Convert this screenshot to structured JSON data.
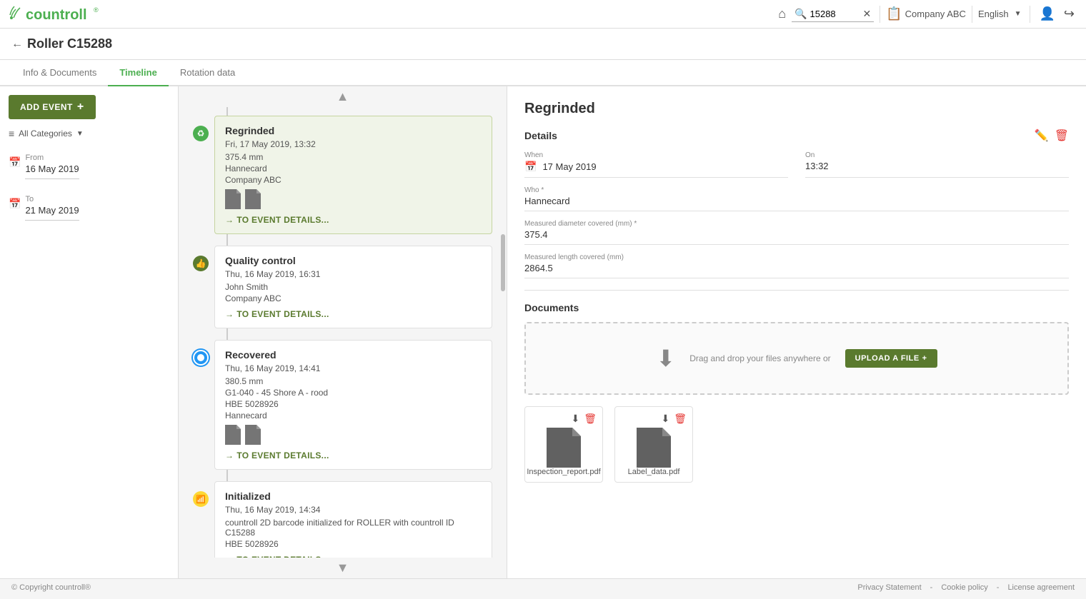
{
  "logo": {
    "text": "countroll",
    "trademark": "®"
  },
  "header": {
    "search_value": "15288",
    "company": "Company ABC",
    "language": "English",
    "home_icon": "home-icon",
    "search_icon": "search-icon",
    "clear_icon": "clear-icon",
    "business_icon": "business-icon",
    "lang_chevron": "chevron-down-icon",
    "account_icon": "account-icon",
    "logout_icon": "logout-icon"
  },
  "page": {
    "back_label": "←",
    "title": "Roller C15288"
  },
  "tabs": [
    {
      "id": "info",
      "label": "Info & Documents"
    },
    {
      "id": "timeline",
      "label": "Timeline"
    },
    {
      "id": "rotation",
      "label": "Rotation data"
    }
  ],
  "active_tab": "timeline",
  "sidebar": {
    "add_event_label": "ADD EVENT",
    "filter_label": "All Categories",
    "from_label": "From",
    "from_value": "16 May 2019",
    "to_label": "To",
    "to_value": "21 May 2019"
  },
  "timeline_events": [
    {
      "id": "evt1",
      "type": "regrinded",
      "title": "Regrinded",
      "datetime": "Fri, 17 May 2019, 13:32",
      "detail1": "375.4 mm",
      "detail2": "Hannecard",
      "detail3": "Company ABC",
      "has_docs": true,
      "link_label": "TO EVENT DETAILS...",
      "node_type": "green_recycle",
      "active": true
    },
    {
      "id": "evt2",
      "type": "quality_control",
      "title": "Quality control",
      "datetime": "Thu, 16 May 2019, 16:31",
      "detail1": "John Smith",
      "detail2": "Company ABC",
      "has_docs": false,
      "link_label": "TO EVENT DETAILS...",
      "node_type": "thumb_up",
      "active": false
    },
    {
      "id": "evt3",
      "type": "recovered",
      "title": "Recovered",
      "datetime": "Thu, 16 May 2019, 14:41",
      "detail1": "380.5 mm",
      "detail2": "G1-040 - 45 Shore A - rood",
      "detail3": "HBE 5028926",
      "detail4": "Hannecard",
      "has_docs": true,
      "link_label": "TO EVENT DETAILS...",
      "node_type": "blue_circle",
      "active": false
    },
    {
      "id": "evt4",
      "type": "initialized",
      "title": "Initialized",
      "datetime": "Thu, 16 May 2019, 14:34",
      "detail1": "countroll 2D barcode initialized for ROLLER with countroll ID C15288",
      "detail2": "HBE 5028926",
      "has_docs": false,
      "link_label": "TO EVENT DETAILS...",
      "node_type": "yellow_wifi",
      "active": false
    }
  ],
  "detail": {
    "title": "Regrinded",
    "section_details": "Details",
    "when_label": "When",
    "when_value": "17 May 2019",
    "on_label": "On",
    "on_value": "13:32",
    "who_label": "Who *",
    "who_value": "Hannecard",
    "diameter_label": "Measured diameter covered (mm) *",
    "diameter_value": "375.4",
    "length_label": "Measured length covered (mm)",
    "length_value": "2864.5",
    "documents_title": "Documents",
    "drag_drop_text": "Drag and drop your files anywhere or",
    "upload_label": "UPLOAD A FILE",
    "files": [
      {
        "name": "Inspection_report.pdf"
      },
      {
        "name": "Label_data.pdf"
      }
    ],
    "edit_icon": "edit-icon",
    "delete_icon": "delete-icon"
  },
  "footer": {
    "copyright": "© Copyright countroll®",
    "links": [
      {
        "label": "Privacy Statement"
      },
      {
        "label": "Cookie policy"
      },
      {
        "label": "License agreement"
      }
    ]
  }
}
